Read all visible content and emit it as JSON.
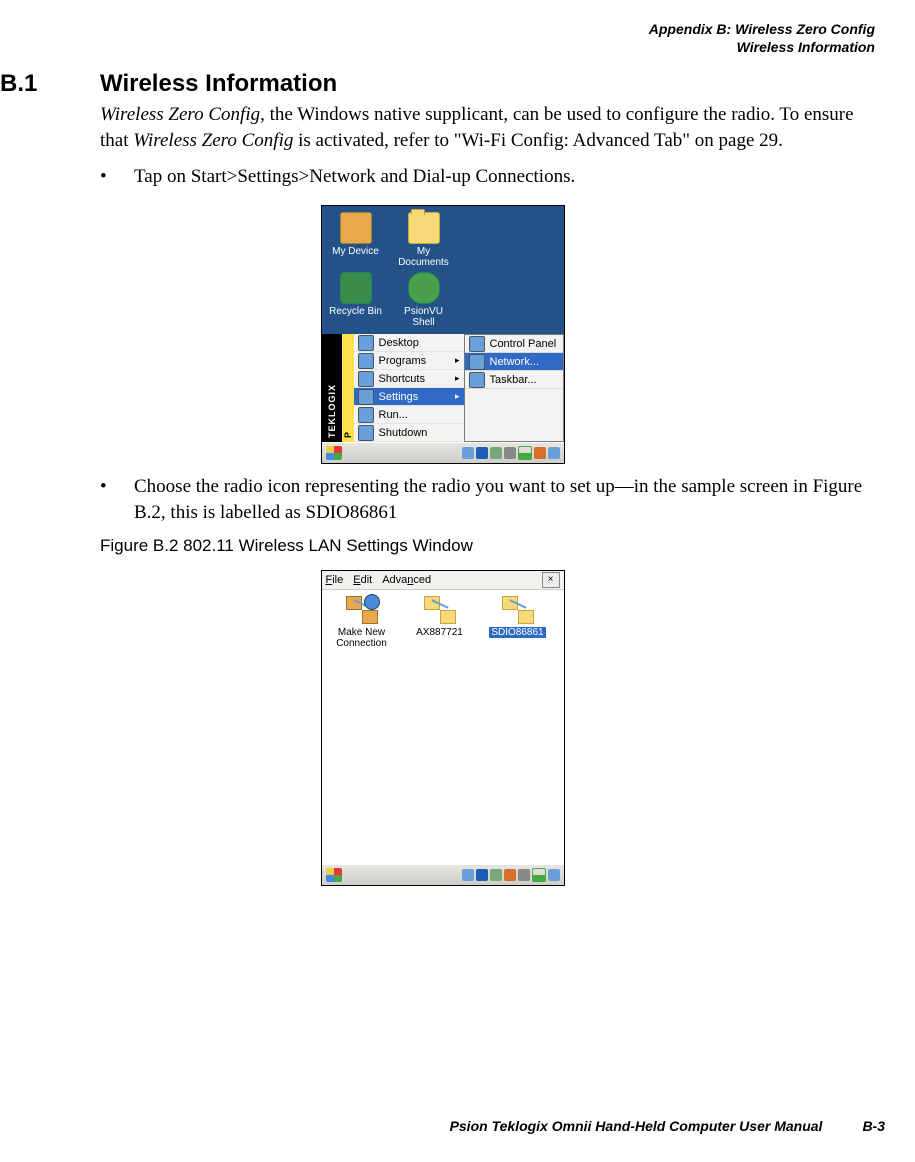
{
  "header": {
    "line1": "Appendix B: Wireless Zero Config",
    "line2": "Wireless Information"
  },
  "section": {
    "number": "B.1",
    "title": "Wireless Information"
  },
  "para1": {
    "frag1": "Wireless Zero Config",
    "frag2": ", the Windows native supplicant, can be used to configure the radio. To ensure that ",
    "frag3": "Wireless Zero Config",
    "frag4": " is activated, refer to \"Wi-Fi Config: Advanced Tab\" on page 29."
  },
  "bullet1": {
    "dot": "•",
    "lead": "Tap on ",
    "bold": "Start>Settings>Network and Dial-up Connections."
  },
  "shot1": {
    "desktop": {
      "my_device": "My Device",
      "my_documents": "My Documents",
      "recycle_bin": "Recycle Bin",
      "psionvu": "PsionVU Shell"
    },
    "teklogix": "TEKLOGIX",
    "p": "P",
    "start_menu": {
      "desktop": "Desktop",
      "programs": "Programs",
      "shortcuts": "Shortcuts",
      "settings": "Settings",
      "run": "Run...",
      "shutdown": "Shutdown"
    },
    "submenu": {
      "control_panel": "Control Panel",
      "network": "Network...",
      "taskbar": "Taskbar..."
    }
  },
  "bullet2": {
    "dot": "•",
    "lead": "Choose the ",
    "bold": "radio icon",
    "rest1": " representing the radio you want to set up—in the sample screen in Figure B.2, this is labelled as ",
    "italic": "SDIO86861"
  },
  "figure_caption": "Figure B.2  802.11 Wireless LAN Settings Window",
  "shot2": {
    "menubar": {
      "file": "File",
      "edit": "Edit",
      "advanced": "Advanced",
      "close": "×"
    },
    "items": {
      "make_new": "Make New Connection",
      "ax": "AX887721",
      "sdio": "SDIO86861"
    }
  },
  "footer": {
    "manual": "Psion Teklogix Omnii Hand-Held Computer User Manual",
    "page": "B-3"
  }
}
